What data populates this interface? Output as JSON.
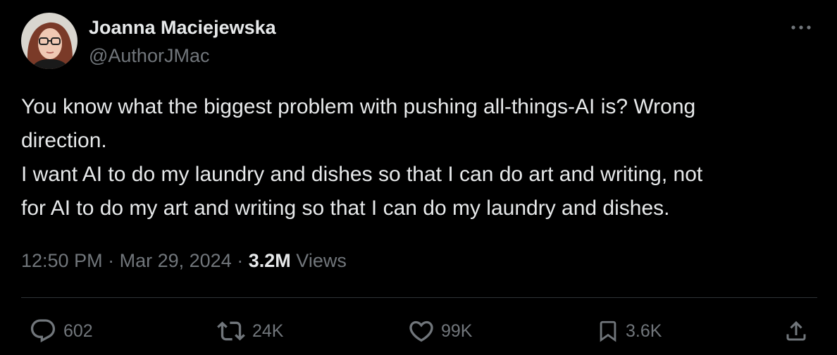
{
  "author": {
    "display_name": "Joanna Maciejewska",
    "handle": "@AuthorJMac",
    "avatar_icon": "profile-photo"
  },
  "tweet": {
    "lines": [
      "You know what the biggest problem with pushing all-things-AI is? Wrong",
      "direction.",
      "I want AI to do my laundry and dishes so that I can do art and writing, not",
      "for AI to do my art and writing so that I can do my laundry and dishes."
    ],
    "time": "12:50 PM",
    "date": "Mar 29, 2024",
    "separator": "·",
    "views_count": "3.2M",
    "views_label": "Views"
  },
  "actions": {
    "replies": "602",
    "reposts": "24K",
    "likes": "99K",
    "bookmarks": "3.6K"
  },
  "icons": {
    "more": "more-icon",
    "reply": "reply-icon",
    "repost": "repost-icon",
    "like": "heart-icon",
    "bookmark": "bookmark-icon",
    "share": "share-icon"
  },
  "colors": {
    "background": "#000000",
    "primary_text": "#e7e9ea",
    "secondary_text": "#71767b",
    "divider": "#2f3336"
  }
}
